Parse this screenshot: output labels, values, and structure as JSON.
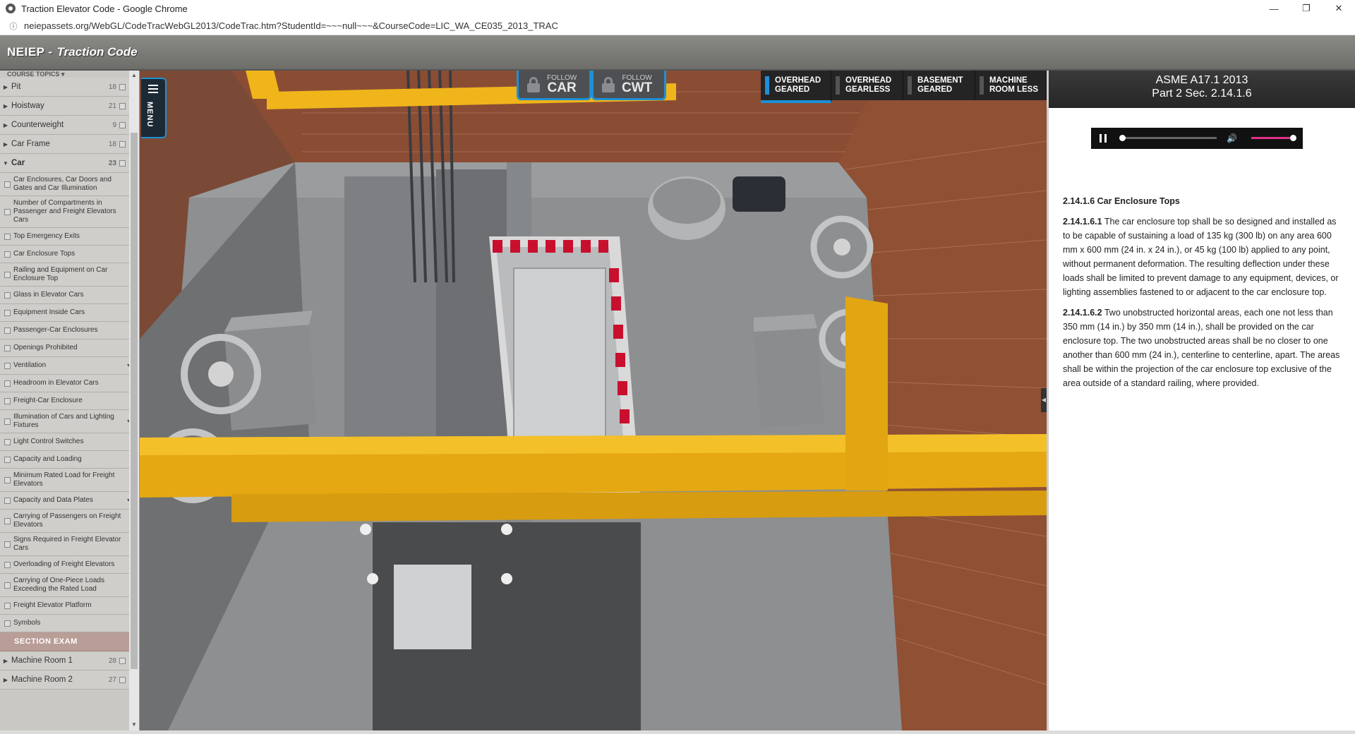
{
  "browser": {
    "window_title": "Traction Elevator Code - Google Chrome",
    "url": "neiepassets.org/WebGL/CodeTracWebGL2013/CodeTrac.htm?StudentId=~~~null~~~&CourseCode=LIC_WA_CE035_2013_TRAC",
    "minimize": "—",
    "maximize": "❐",
    "close": "✕"
  },
  "app": {
    "brand": "NEIEP -",
    "subtitle": "Traction Code"
  },
  "sidebar": {
    "header": "COURSE TOPICS ▾",
    "top_items": [
      {
        "label": "Pit",
        "count": "18"
      },
      {
        "label": "Hoistway",
        "count": "21"
      },
      {
        "label": "Counterweight",
        "count": "9"
      },
      {
        "label": "Car Frame",
        "count": "18"
      },
      {
        "label": "Car",
        "count": "23"
      }
    ],
    "car_subitems": [
      {
        "label": "Car Enclosures, Car Doors and Gates and Car Illumination"
      },
      {
        "label": "Number of Compartments in Passenger and Freight Elevators Cars"
      },
      {
        "label": "Top Emergency Exits"
      },
      {
        "label": "Car Enclosure Tops"
      },
      {
        "label": "Railing and Equipment on Car Enclosure Top"
      },
      {
        "label": "Glass in Elevator Cars"
      },
      {
        "label": "Equipment Inside Cars"
      },
      {
        "label": "Passenger-Car Enclosures"
      },
      {
        "label": "Openings Prohibited"
      },
      {
        "label": "Ventilation",
        "caret": "▾"
      },
      {
        "label": "Headroom in Elevator Cars"
      },
      {
        "label": "Freight-Car Enclosure"
      },
      {
        "label": "Illumination of Cars and Lighting Fixtures",
        "caret": "▾"
      },
      {
        "label": "Light Control Switches"
      },
      {
        "label": "Capacity and Loading"
      },
      {
        "label": "Minimum Rated Load for Freight Elevators"
      },
      {
        "label": "Capacity and Data Plates",
        "caret": "▾"
      },
      {
        "label": "Carrying of Passengers on Freight Elevators"
      },
      {
        "label": "Signs Required in Freight Elevator Cars"
      },
      {
        "label": "Overloading of Freight Elevators"
      },
      {
        "label": "Carrying of One-Piece Loads Exceeding the Rated Load"
      },
      {
        "label": "Freight Elevator Platform"
      },
      {
        "label": "Symbols"
      }
    ],
    "section_exam": "SECTION EXAM",
    "bottom_items": [
      {
        "label": "Machine Room 1",
        "count": "28"
      },
      {
        "label": "Machine Room 2",
        "count": "27"
      }
    ]
  },
  "viewport": {
    "menu_label": "MENU",
    "follow_car": {
      "small": "FOLLOW",
      "big": "CAR"
    },
    "follow_cwt": {
      "small": "FOLLOW",
      "big": "CWT"
    },
    "model_tabs": [
      {
        "line1": "OVERHEAD",
        "line2": "GEARED",
        "active": true
      },
      {
        "line1": "OVERHEAD",
        "line2": "GEARLESS",
        "active": false
      },
      {
        "line1": "BASEMENT",
        "line2": "GEARED",
        "active": false
      },
      {
        "line1": "MACHINE",
        "line2": "ROOM LESS",
        "active": false
      }
    ]
  },
  "code_panel": {
    "title_line1": "ASME A17.1 2013",
    "title_line2": "Part 2 Sec. 2.14.1.6",
    "heading": "2.14.1.6 Car Enclosure Tops",
    "p1_num": "2.14.1.6.1",
    "p1_text": " The car enclosure top shall be so designed and installed as to be capable of sustaining a load of 135 kg (300 lb) on any area 600 mm x 600 mm (24 in. x 24 in.), or 45 kg (100 lb) applied to any point, without permanent deformation. The resulting deflection under these loads shall be limited to prevent damage to any equipment, devices, or lighting assemblies fastened to or adjacent to the car enclosure top.",
    "p2_num": "2.14.1.6.2",
    "p2_text": " Two unobstructed horizontal areas, each one not less than 350 mm (14 in.) by 350 mm (14 in.), shall be provided on the car enclosure top. The two unobstructed areas shall be no closer to one another than 600 mm (24 in.), centerline to centerline, apart. The areas shall be within the projection of the car enclosure top exclusive of the area outside of a standard railing, where provided.",
    "volume_icon": "🔊"
  }
}
